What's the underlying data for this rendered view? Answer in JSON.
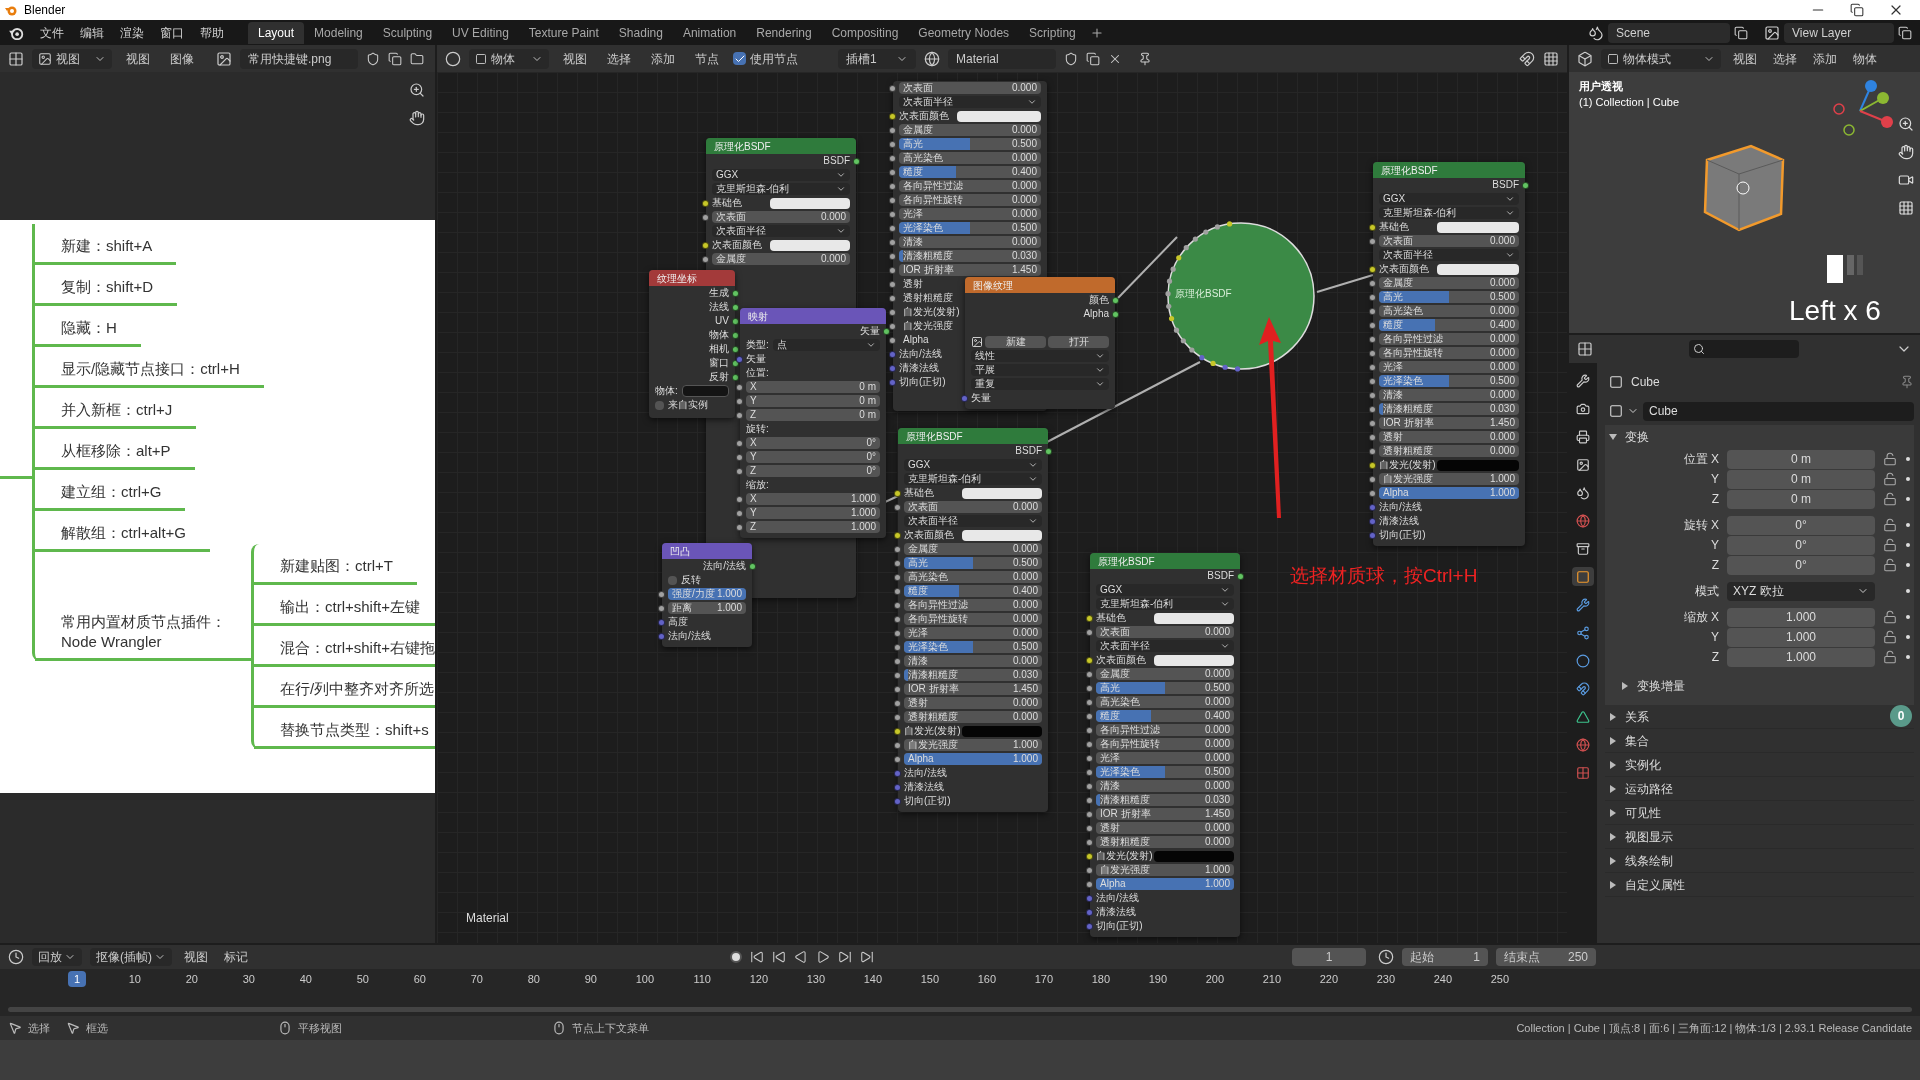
{
  "title_bar": {
    "title": "Blender"
  },
  "menu": [
    "文件",
    "编辑",
    "渲染",
    "窗口",
    "帮助"
  ],
  "workspaces": [
    {
      "label": "Layout",
      "selected": true
    },
    {
      "label": "Modeling",
      "selected": false
    },
    {
      "label": "Sculpting",
      "selected": false
    },
    {
      "label": "UV Editing",
      "selected": false
    },
    {
      "label": "Texture Paint",
      "selected": false
    },
    {
      "label": "Shading",
      "selected": false
    },
    {
      "label": "Animation",
      "selected": false
    },
    {
      "label": "Rendering",
      "selected": false
    },
    {
      "label": "Compositing",
      "selected": false
    },
    {
      "label": "Geometry Nodes",
      "selected": false
    },
    {
      "label": "Scripting",
      "selected": false
    }
  ],
  "scene": "Scene",
  "view_layer": "View Layer",
  "image_editor": {
    "view_dropdown": "视图",
    "menus": [
      "视图",
      "图像"
    ],
    "image_name": "常用快捷键.png",
    "mindmap": {
      "branches": [
        "新建：shift+A",
        "复制：shift+D",
        "隐藏：H",
        "显示/隐藏节点接口：ctrl+H",
        "并入新框：ctrl+J",
        "从框移除：alt+P",
        "建立组：ctrl+G",
        "解散组：ctrl+alt+G"
      ],
      "plugin": [
        "常用内置材质节点插件：",
        "Node Wrangler"
      ],
      "plugin_items": [
        "新建贴图：ctrl+T",
        "输出：ctrl+shift+左键",
        "混合：ctrl+shift+右键拖",
        "在行/列中整齐对齐所选",
        "替换节点类型：shift+s"
      ]
    }
  },
  "node_editor": {
    "object_dropdown": "物体",
    "menus": [
      "视图",
      "选择",
      "添加",
      "节点"
    ],
    "use_nodes": {
      "label": "使用节点",
      "checked": true
    },
    "slot": "插槽1",
    "material": "Material",
    "material_label": "Material",
    "note": "选择材质球，按Ctrl+H",
    "nodes": [
      {
        "kind": "bsdf",
        "title": "原理化BSDF",
        "rows": [
          {
            "kind": "output",
            "label": "BSDF"
          },
          {
            "kind": "dropdown",
            "label": "GGX"
          },
          {
            "kind": "dropdown",
            "label": "克里斯坦森-伯利"
          },
          {
            "kind": "color",
            "label": "基础色",
            "color": "#e8e8e8"
          },
          {
            "kind": "value",
            "label": "次表面",
            "value": "0.000"
          },
          {
            "kind": "dropdown",
            "label": "次表面半径"
          },
          {
            "kind": "color",
            "label": "次表面颜色",
            "color": "#e8e8e8"
          },
          {
            "kind": "value",
            "label": "金属度",
            "value": "0.000"
          }
        ]
      },
      {
        "kind": "texcoord",
        "title": "纹理坐标",
        "rows": [
          {
            "kind": "output",
            "label": "生成"
          },
          {
            "kind": "output",
            "label": "法线"
          },
          {
            "kind": "output",
            "label": "UV"
          },
          {
            "kind": "output",
            "label": "物体"
          },
          {
            "kind": "output",
            "label": "相机"
          },
          {
            "kind": "output",
            "label": "窗口"
          },
          {
            "kind": "output",
            "label": "反射"
          },
          {
            "kind": "field",
            "label": "物体:"
          },
          {
            "kind": "checkbox",
            "label": "来自实例",
            "checked": false
          }
        ]
      },
      {
        "kind": "mapping",
        "title": "映射",
        "rows": [
          {
            "kind": "output",
            "label": "矢量"
          },
          {
            "kind": "select",
            "label": "类型:",
            "value": "点"
          },
          {
            "kind": "socket",
            "label": "矢量"
          },
          {
            "kind": "section",
            "label": "位置:"
          },
          {
            "kind": "value",
            "label": "X",
            "value": "0 m"
          },
          {
            "kind": "value",
            "label": "Y",
            "value": "0 m"
          },
          {
            "kind": "value",
            "label": "Z",
            "value": "0 m"
          },
          {
            "kind": "section",
            "label": "旋转:"
          },
          {
            "kind": "value",
            "label": "X",
            "value": "0°"
          },
          {
            "kind": "value",
            "label": "Y",
            "value": "0°"
          },
          {
            "kind": "value",
            "label": "Z",
            "value": "0°"
          },
          {
            "kind": "section",
            "label": "缩放:"
          },
          {
            "kind": "value",
            "label": "X",
            "value": "1.000"
          },
          {
            "kind": "value",
            "label": "Y",
            "value": "1.000"
          },
          {
            "kind": "value",
            "label": "Z",
            "value": "1.000"
          }
        ]
      },
      {
        "kind": "bsdf",
        "rows": [
          {
            "kind": "value",
            "label": "次表面",
            "value": "0.000"
          },
          {
            "kind": "dropdown",
            "label": "次表面半径"
          },
          {
            "kind": "color",
            "label": "次表面颜色",
            "color": "#e8e8e8"
          },
          {
            "kind": "value",
            "label": "金属度",
            "value": "0.000"
          },
          {
            "kind": "value",
            "label": "高光",
            "value": "0.500",
            "level": 0.5
          },
          {
            "kind": "value",
            "label": "高光染色",
            "value": "0.000"
          },
          {
            "kind": "value",
            "label": "糙度",
            "value": "0.400",
            "level": 0.4
          },
          {
            "kind": "value",
            "label": "各向异性过滤",
            "value": "0.000"
          },
          {
            "kind": "value",
            "label": "各向异性旋转",
            "value": "0.000"
          },
          {
            "kind": "value",
            "label": "光泽",
            "value": "0.000"
          },
          {
            "kind": "value",
            "label": "光泽染色",
            "value": "0.500",
            "level": 0.5
          },
          {
            "kind": "value",
            "label": "清漆",
            "value": "0.000"
          },
          {
            "kind": "value",
            "label": "清漆粗糙度",
            "value": "0.030",
            "level": 0.03
          },
          {
            "kind": "value",
            "label": "IOR 折射率",
            "value": "1.450"
          },
          {
            "kind": "plain",
            "label": "透射"
          },
          {
            "kind": "plain",
            "label": "透射粗糙度"
          },
          {
            "kind": "plain",
            "label": "自发光(发射)"
          },
          {
            "kind": "plain",
            "label": "自发光强度"
          },
          {
            "kind": "plain",
            "label": "Alpha"
          },
          {
            "kind": "socket",
            "label": "法向/法线"
          },
          {
            "kind": "socket",
            "label": "清漆法线"
          },
          {
            "kind": "socket",
            "label": "切向(正切)"
          }
        ]
      },
      {
        "kind": "image",
        "title": "图像纹理",
        "rows": [
          {
            "kind": "output",
            "label": "颜色"
          },
          {
            "kind": "output",
            "label": "Alpha"
          },
          {
            "kind": "spacer"
          },
          {
            "kind": "buttons",
            "buttons": [
              "新建",
              "打开"
            ]
          },
          {
            "kind": "dropdown",
            "label": "线性"
          },
          {
            "kind": "dropdown",
            "label": "平展"
          },
          {
            "kind": "dropdown",
            "label": "重复"
          },
          {
            "kind": "socket",
            "label": "矢量"
          }
        ]
      },
      {
        "kind": "bump",
        "title": "凹凸",
        "rows": [
          {
            "kind": "output",
            "label": "法向/法线"
          },
          {
            "kind": "checkbox",
            "label": "反转",
            "checked": false
          },
          {
            "kind": "value",
            "label": "强度/力度",
            "value": "1.000",
            "level": 1
          },
          {
            "kind": "value",
            "label": "距离",
            "value": "1.000"
          },
          {
            "kind": "socket",
            "label": "高度"
          },
          {
            "kind": "socket",
            "label": "法向/法线"
          }
        ]
      },
      {
        "kind": "bsdf",
        "title": "原理化BSDF",
        "rows": [
          {
            "kind": "output",
            "label": "BSDF"
          },
          {
            "kind": "dropdown",
            "label": "GGX"
          },
          {
            "kind": "dropdown",
            "label": "克里斯坦森-伯利"
          },
          {
            "kind": "color",
            "label": "基础色",
            "color": "#e8e8e8"
          },
          {
            "kind": "value",
            "label": "次表面",
            "value": "0.000"
          },
          {
            "kind": "dropdown",
            "label": "次表面半径"
          },
          {
            "kind": "color",
            "label": "次表面颜色",
            "color": "#e8e8e8"
          },
          {
            "kind": "value",
            "label": "金属度",
            "value": "0.000"
          },
          {
            "kind": "value",
            "label": "高光",
            "value": "0.500",
            "level": 0.5
          },
          {
            "kind": "value",
            "label": "高光染色",
            "value": "0.000"
          },
          {
            "kind": "value",
            "label": "糙度",
            "value": "0.400",
            "level": 0.4
          },
          {
            "kind": "value",
            "label": "各向异性过滤",
            "value": "0.000"
          },
          {
            "kind": "value",
            "label": "各向异性旋转",
            "value": "0.000"
          },
          {
            "kind": "value",
            "label": "光泽",
            "value": "0.000"
          },
          {
            "kind": "value",
            "label": "光泽染色",
            "value": "0.500",
            "level": 0.5
          },
          {
            "kind": "value",
            "label": "清漆",
            "value": "0.000"
          },
          {
            "kind": "value",
            "label": "清漆粗糙度",
            "value": "0.030",
            "level": 0.03
          },
          {
            "kind": "value",
            "label": "IOR 折射率",
            "value": "1.450"
          },
          {
            "kind": "value",
            "label": "透射",
            "value": "0.000"
          },
          {
            "kind": "value",
            "label": "透射粗糙度",
            "value": "0.000"
          },
          {
            "kind": "color",
            "label": "自发光(发射)",
            "color": "#050505"
          },
          {
            "kind": "value",
            "label": "自发光强度",
            "value": "1.000"
          },
          {
            "kind": "value",
            "label": "Alpha",
            "value": "1.000",
            "level": 1
          },
          {
            "kind": "socket",
            "label": "法向/法线"
          },
          {
            "kind": "socket",
            "label": "清漆法线"
          },
          {
            "kind": "socket",
            "label": "切向(正切)"
          }
        ]
      },
      {
        "kind": "collapsed",
        "title": "原理化BSDF"
      },
      {
        "kind": "bsdf",
        "title": "原理化BSDF",
        "rows": [
          {
            "kind": "output",
            "label": "BSDF"
          },
          {
            "kind": "dropdown",
            "label": "GGX"
          },
          {
            "kind": "dropdown",
            "label": "克里斯坦森-伯利"
          },
          {
            "kind": "color",
            "label": "基础色",
            "color": "#e8e8e8"
          },
          {
            "kind": "value",
            "label": "次表面",
            "value": "0.000"
          },
          {
            "kind": "dropdown",
            "label": "次表面半径"
          },
          {
            "kind": "color",
            "label": "次表面颜色",
            "color": "#e8e8e8"
          },
          {
            "kind": "value",
            "label": "金属度",
            "value": "0.000"
          },
          {
            "kind": "value",
            "label": "高光",
            "value": "0.500",
            "level": 0.5
          },
          {
            "kind": "value",
            "label": "高光染色",
            "value": "0.000"
          },
          {
            "kind": "value",
            "label": "糙度",
            "value": "0.400",
            "level": 0.4
          },
          {
            "kind": "value",
            "label": "各向异性过滤",
            "value": "0.000"
          },
          {
            "kind": "value",
            "label": "各向异性旋转",
            "value": "0.000"
          },
          {
            "kind": "value",
            "label": "光泽",
            "value": "0.000"
          },
          {
            "kind": "value",
            "label": "光泽染色",
            "value": "0.500",
            "level": 0.5
          },
          {
            "kind": "value",
            "label": "清漆",
            "value": "0.000"
          },
          {
            "kind": "value",
            "label": "清漆粗糙度",
            "value": "0.030",
            "level": 0.03
          },
          {
            "kind": "value",
            "label": "IOR 折射率",
            "value": "1.450"
          },
          {
            "kind": "value",
            "label": "透射",
            "value": "0.000"
          },
          {
            "kind": "value",
            "label": "透射粗糙度",
            "value": "0.000"
          },
          {
            "kind": "color",
            "label": "自发光(发射)",
            "color": "#050505"
          },
          {
            "kind": "value",
            "label": "自发光强度",
            "value": "1.000"
          },
          {
            "kind": "value",
            "label": "Alpha",
            "value": "1.000",
            "level": 1
          },
          {
            "kind": "socket",
            "label": "法向/法线"
          },
          {
            "kind": "socket",
            "label": "清漆法线"
          },
          {
            "kind": "socket",
            "label": "切向(正切)"
          }
        ]
      },
      {
        "kind": "bsdf",
        "title": "原理化BSDF",
        "rows": [
          {
            "kind": "output",
            "label": "BSDF"
          },
          {
            "kind": "dropdown",
            "label": "GGX"
          },
          {
            "kind": "dropdown",
            "label": "克里斯坦森-伯利"
          },
          {
            "kind": "color",
            "label": "基础色",
            "color": "#e8e8e8"
          },
          {
            "kind": "value",
            "label": "次表面",
            "value": "0.000"
          },
          {
            "kind": "dropdown",
            "label": "次表面半径"
          },
          {
            "kind": "color",
            "label": "次表面颜色",
            "color": "#e8e8e8"
          },
          {
            "kind": "value",
            "label": "金属度",
            "value": "0.000"
          },
          {
            "kind": "value",
            "label": "高光",
            "value": "0.500",
            "level": 0.5
          },
          {
            "kind": "value",
            "label": "高光染色",
            "value": "0.000"
          },
          {
            "kind": "value",
            "label": "糙度",
            "value": "0.400",
            "level": 0.4
          },
          {
            "kind": "value",
            "label": "各向异性过滤",
            "value": "0.000"
          },
          {
            "kind": "value",
            "label": "各向异性旋转",
            "value": "0.000"
          },
          {
            "kind": "value",
            "label": "光泽",
            "value": "0.000"
          },
          {
            "kind": "value",
            "label": "光泽染色",
            "value": "0.500",
            "level": 0.5
          },
          {
            "kind": "value",
            "label": "清漆",
            "value": "0.000"
          },
          {
            "kind": "value",
            "label": "清漆粗糙度",
            "value": "0.030",
            "level": 0.03
          },
          {
            "kind": "value",
            "label": "IOR 折射率",
            "value": "1.450"
          },
          {
            "kind": "value",
            "label": "透射",
            "value": "0.000"
          },
          {
            "kind": "value",
            "label": "透射粗糙度",
            "value": "0.000"
          },
          {
            "kind": "color",
            "label": "自发光(发射)",
            "color": "#050505"
          },
          {
            "kind": "value",
            "label": "自发光强度",
            "value": "1.000"
          },
          {
            "kind": "value",
            "label": "Alpha",
            "value": "1.000",
            "level": 1
          },
          {
            "kind": "socket",
            "label": "法向/法线"
          },
          {
            "kind": "socket",
            "label": "清漆法线"
          },
          {
            "kind": "socket",
            "label": "切向(正切)"
          }
        ]
      }
    ]
  },
  "viewport": {
    "mode": "物体模式",
    "menus": [
      "视图",
      "选择",
      "添加",
      "物体"
    ],
    "view_name": "用户透视",
    "collection": "(1) Collection | Cube",
    "overlay_text": "Left x 6"
  },
  "properties": {
    "object": "Cube",
    "data_name": "Cube",
    "section": {
      "label": "变换",
      "expanded": true
    },
    "rows": [
      {
        "kind": "number",
        "label": "位置 X",
        "value": "0 m"
      },
      {
        "kind": "number",
        "label": "Y",
        "value": "0 m"
      },
      {
        "kind": "number",
        "label": "Z",
        "value": "0 m"
      },
      {
        "kind": "number",
        "label": "旋转 X",
        "value": "0°"
      },
      {
        "kind": "number",
        "label": "Y",
        "value": "0°"
      },
      {
        "kind": "number",
        "label": "Z",
        "value": "0°"
      },
      {
        "kind": "select",
        "label": "模式",
        "value": "XYZ 欧拉"
      },
      {
        "kind": "number",
        "label": "缩放 X",
        "value": "1.000"
      },
      {
        "kind": "number",
        "label": "Y",
        "value": "1.000"
      },
      {
        "kind": "number",
        "label": "Z",
        "value": "1.000"
      }
    ],
    "subpanel": "变换增量",
    "badge": "0",
    "panels": [
      "关系",
      "集合",
      "实例化",
      "运动路径",
      "可见性",
      "视图显示",
      "线条绘制",
      "自定义属性"
    ]
  },
  "timeline": {
    "menus": [
      "回放",
      "抠像(插帧)"
    ],
    "plain_menus": [
      "视图",
      "标记"
    ],
    "current_frame": "1",
    "start_label": "起始",
    "start": "1",
    "end_label": "结束点",
    "end": "250",
    "ticks": [
      "1",
      "10",
      "20",
      "30",
      "40",
      "50",
      "60",
      "70",
      "80",
      "90",
      "100",
      "110",
      "120",
      "130",
      "140",
      "150",
      "160",
      "170",
      "180",
      "190",
      "200",
      "210",
      "220",
      "230",
      "240",
      "250"
    ]
  },
  "status_bar": {
    "items": [
      "选择",
      "框选",
      "平移视图",
      "节点上下文菜单"
    ],
    "info": "Collection | Cube | 顶点:8 | 面:6 | 三角面:12 | 物体:1/3 | 2.93.1 Release Candidate"
  }
}
